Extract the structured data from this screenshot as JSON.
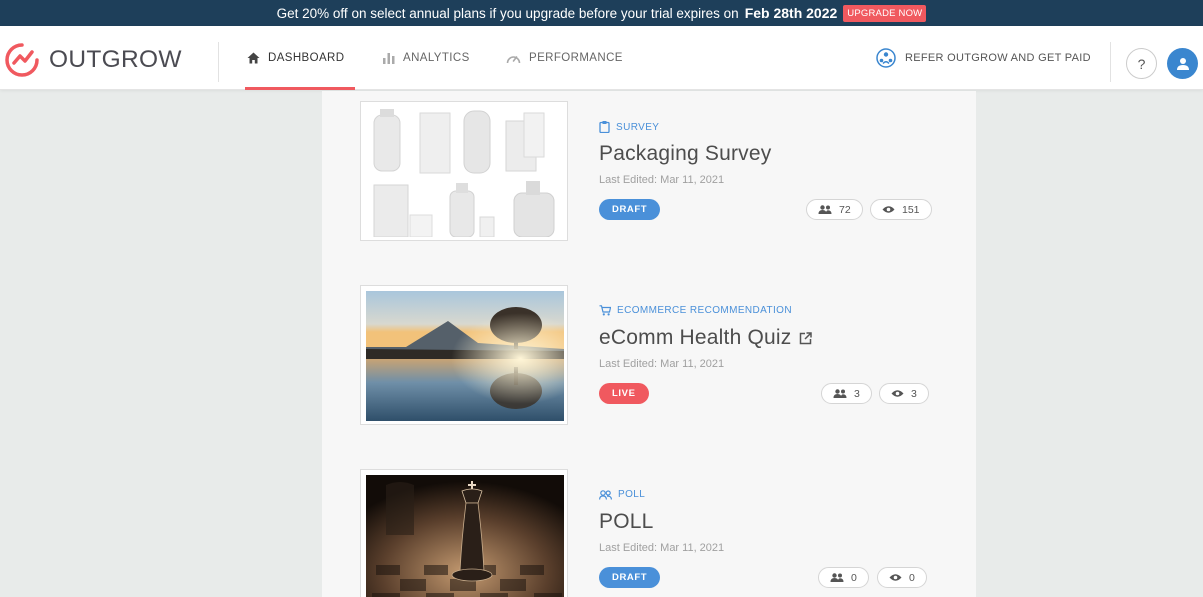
{
  "banner": {
    "text": "Get 20% off on select annual plans if you upgrade before your trial expires on",
    "date": "Feb 28th 2022",
    "cta": "UPGRADE NOW"
  },
  "brand": {
    "name": "OUTGROW",
    "accent": "#f0595f",
    "primary": "#4a90d9",
    "banner_bg": "#1e3f5a"
  },
  "nav": {
    "dashboard": "DASHBOARD",
    "analytics": "ANALYTICS",
    "performance": "PERFORMANCE"
  },
  "header": {
    "refer": "REFER OUTGROW AND GET PAID",
    "help": "?"
  },
  "cards": [
    {
      "type": "SURVEY",
      "type_icon": "clipboard-icon",
      "title": "Packaging Survey",
      "edited": "Last Edited: Mar 11, 2021",
      "status": "DRAFT",
      "leads": "72",
      "views": "151"
    },
    {
      "type": "ECOMMERCE RECOMMENDATION",
      "type_icon": "cart-icon",
      "title": "eComm Health Quiz",
      "edited": "Last Edited: Mar 11, 2021",
      "status": "LIVE",
      "leads": "3",
      "views": "3"
    },
    {
      "type": "POLL",
      "type_icon": "people-icon",
      "title": "POLL",
      "edited": "Last Edited: Mar 11, 2021",
      "status": "DRAFT",
      "leads": "0",
      "views": "0"
    }
  ]
}
